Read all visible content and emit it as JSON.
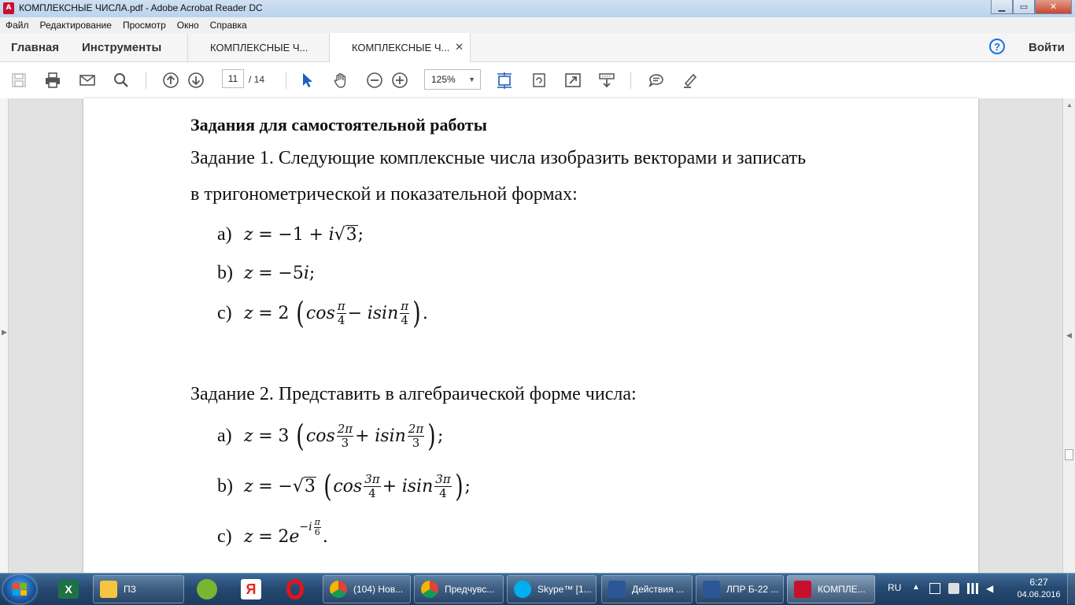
{
  "window": {
    "title": "КОМПЛЕКСНЫЕ ЧИСЛА.pdf - Adobe Acrobat Reader DC",
    "controls": {
      "minimize": "▁",
      "maximize": "▭",
      "close": "✕"
    }
  },
  "menu": [
    "Файл",
    "Редактирование",
    "Просмотр",
    "Окно",
    "Справка"
  ],
  "tabs": {
    "home": "Главная",
    "tools": "Инструменты",
    "doc1": "КОМПЛЕКСНЫЕ Ч...",
    "doc2": "КОМПЛЕКСНЫЕ Ч...",
    "close": "✕"
  },
  "header_right": {
    "help": "?",
    "sign_in": "Войти"
  },
  "toolbar": {
    "page_current": "11",
    "page_total": "/ 14",
    "zoom": "125%",
    "icons": [
      "save-icon",
      "print-icon",
      "email-icon",
      "search-icon",
      "page-up-icon",
      "page-down-icon",
      "select-icon",
      "hand-icon",
      "zoom-out-icon",
      "zoom-in-icon",
      "fit-page-icon",
      "rotate-icon",
      "fullscreen-icon",
      "read-mode-icon",
      "comment-icon",
      "highlight-icon"
    ]
  },
  "document": {
    "heading": "Задания для самостоятельной работы",
    "task1_line1": "Задание 1. Следующие комплексные числа изобразить векторами и записать",
    "task1_line2": "в тригонометрической и показательной формах:",
    "task1_items": [
      {
        "label": "a)",
        "expr": "z = −1 + i√3;"
      },
      {
        "label": "b)",
        "expr": "z = −5i;"
      },
      {
        "label": "c)",
        "expr": "z = 2 (cos π/4 − isin π/4)."
      }
    ],
    "task2_line": "Задание 2.  Представить в алгебраической форме числа:",
    "task2_items": [
      {
        "label": "a)",
        "expr": "z = 3 (cos 2π/3 + isin 2π/3);"
      },
      {
        "label": "b)",
        "expr": "z = −√3 (cos 3π/4 + isin 3π/4);"
      },
      {
        "label": "c)",
        "expr": "z = 2e^(−i π/6)."
      }
    ],
    "math": {
      "z": "z",
      "eq": "=",
      "minus": "−",
      "plus": "+",
      "one": "1",
      "two": "2",
      "three": "3",
      "five": "5",
      "i": "i",
      "cos": "cos",
      "isin": "isin",
      "e": "e",
      "pi": "π",
      "twopi": "2π",
      "threepi": "3π",
      "four": "4",
      "six": "6",
      "semicolon": ";",
      "period": ".",
      "lparen": "(",
      "rparen": ")",
      "neg_i": "−i"
    }
  },
  "taskbar": {
    "pinned": [
      "Excel",
      "Яндекс.Диск",
      "uTorrent",
      "Яндекс",
      "Opera"
    ],
    "tasks": [
      {
        "label": "ПЗ",
        "color": "#f5c542"
      },
      {
        "label": "(104) Нов...",
        "color": "#e8b21f"
      },
      {
        "label": "Предчувс...",
        "color": "#e8b21f"
      },
      {
        "label": "Skype™ [1...",
        "color": "#00aff0"
      },
      {
        "label": "Действия ...",
        "color": "#2b5797"
      },
      {
        "label": "ЛПР Б-22 ...",
        "color": "#2b5797"
      },
      {
        "label": "КОМПЛЕ...",
        "color": "#c8102e"
      }
    ],
    "tray": {
      "lang": "RU",
      "time": "6:27",
      "date": "04.06.2016"
    }
  }
}
